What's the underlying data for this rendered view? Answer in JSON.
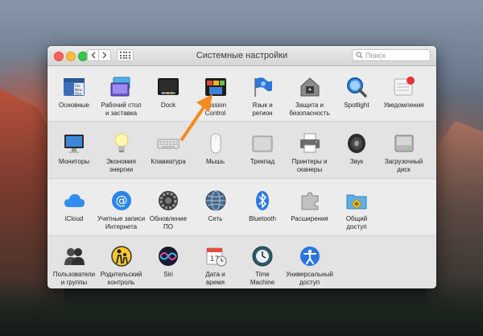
{
  "window": {
    "title": "Системные настройки",
    "search_placeholder": "Поиск"
  },
  "colors": {
    "accent_arrow": "#f58a1e",
    "window_bg": "#ececec"
  },
  "rows": [
    {
      "items": [
        {
          "id": "general",
          "label": "Основные",
          "icon": "general-icon",
          "ic_text": "File New Ope"
        },
        {
          "id": "desktop",
          "label": "Рабочий стол\nи заставка",
          "icon": "desktop-screensaver-icon"
        },
        {
          "id": "dock",
          "label": "Dock",
          "icon": "dock-icon"
        },
        {
          "id": "mission",
          "label": "Mission\nControl",
          "icon": "mission-control-icon"
        },
        {
          "id": "language",
          "label": "Язык и\nрегион",
          "icon": "flag-icon"
        },
        {
          "id": "security",
          "label": "Защита и\nбезопасность",
          "icon": "house-lock-icon"
        },
        {
          "id": "spotlight",
          "label": "Spotlight",
          "icon": "magnifier-icon"
        },
        {
          "id": "notifications",
          "label": "Уведомления",
          "icon": "notifications-icon"
        }
      ]
    },
    {
      "items": [
        {
          "id": "displays",
          "label": "Мониторы",
          "icon": "monitor-icon"
        },
        {
          "id": "energy",
          "label": "Экономия\nэнергии",
          "icon": "lightbulb-icon"
        },
        {
          "id": "keyboard",
          "label": "Клавиатура",
          "icon": "keyboard-icon"
        },
        {
          "id": "mouse",
          "label": "Мышь",
          "icon": "mouse-icon"
        },
        {
          "id": "trackpad",
          "label": "Трекпад",
          "icon": "trackpad-icon"
        },
        {
          "id": "printers",
          "label": "Принтеры и\nсканеры",
          "icon": "printer-icon"
        },
        {
          "id": "sound",
          "label": "Звук",
          "icon": "speaker-icon"
        },
        {
          "id": "startup",
          "label": "Загрузочный\nдиск",
          "icon": "disk-icon"
        }
      ]
    },
    {
      "items": [
        {
          "id": "icloud",
          "label": "iCloud",
          "icon": "cloud-icon"
        },
        {
          "id": "internet",
          "label": "Учетные записи\nИнтернета",
          "icon": "at-sign-icon"
        },
        {
          "id": "update",
          "label": "Обновление\nПО",
          "icon": "gear-icon"
        },
        {
          "id": "network",
          "label": "Сеть",
          "icon": "globe-icon"
        },
        {
          "id": "bluetooth",
          "label": "Bluetooth",
          "icon": "bluetooth-icon"
        },
        {
          "id": "extensions",
          "label": "Расширения",
          "icon": "puzzle-icon"
        },
        {
          "id": "sharing",
          "label": "Общий\nдоступ",
          "icon": "sharing-folder-icon"
        }
      ]
    },
    {
      "items": [
        {
          "id": "users",
          "label": "Пользователи\nи группы",
          "icon": "users-icon"
        },
        {
          "id": "parental",
          "label": "Родительский\nконтроль",
          "icon": "parental-icon"
        },
        {
          "id": "siri",
          "label": "Siri",
          "icon": "siri-icon"
        },
        {
          "id": "datetime",
          "label": "Дата и\nвремя",
          "icon": "calendar-clock-icon"
        },
        {
          "id": "timemachine",
          "label": "Time\nMachine",
          "icon": "time-machine-icon"
        },
        {
          "id": "accessibility",
          "label": "Универсальный\nдоступ",
          "icon": "accessibility-icon"
        }
      ]
    }
  ]
}
